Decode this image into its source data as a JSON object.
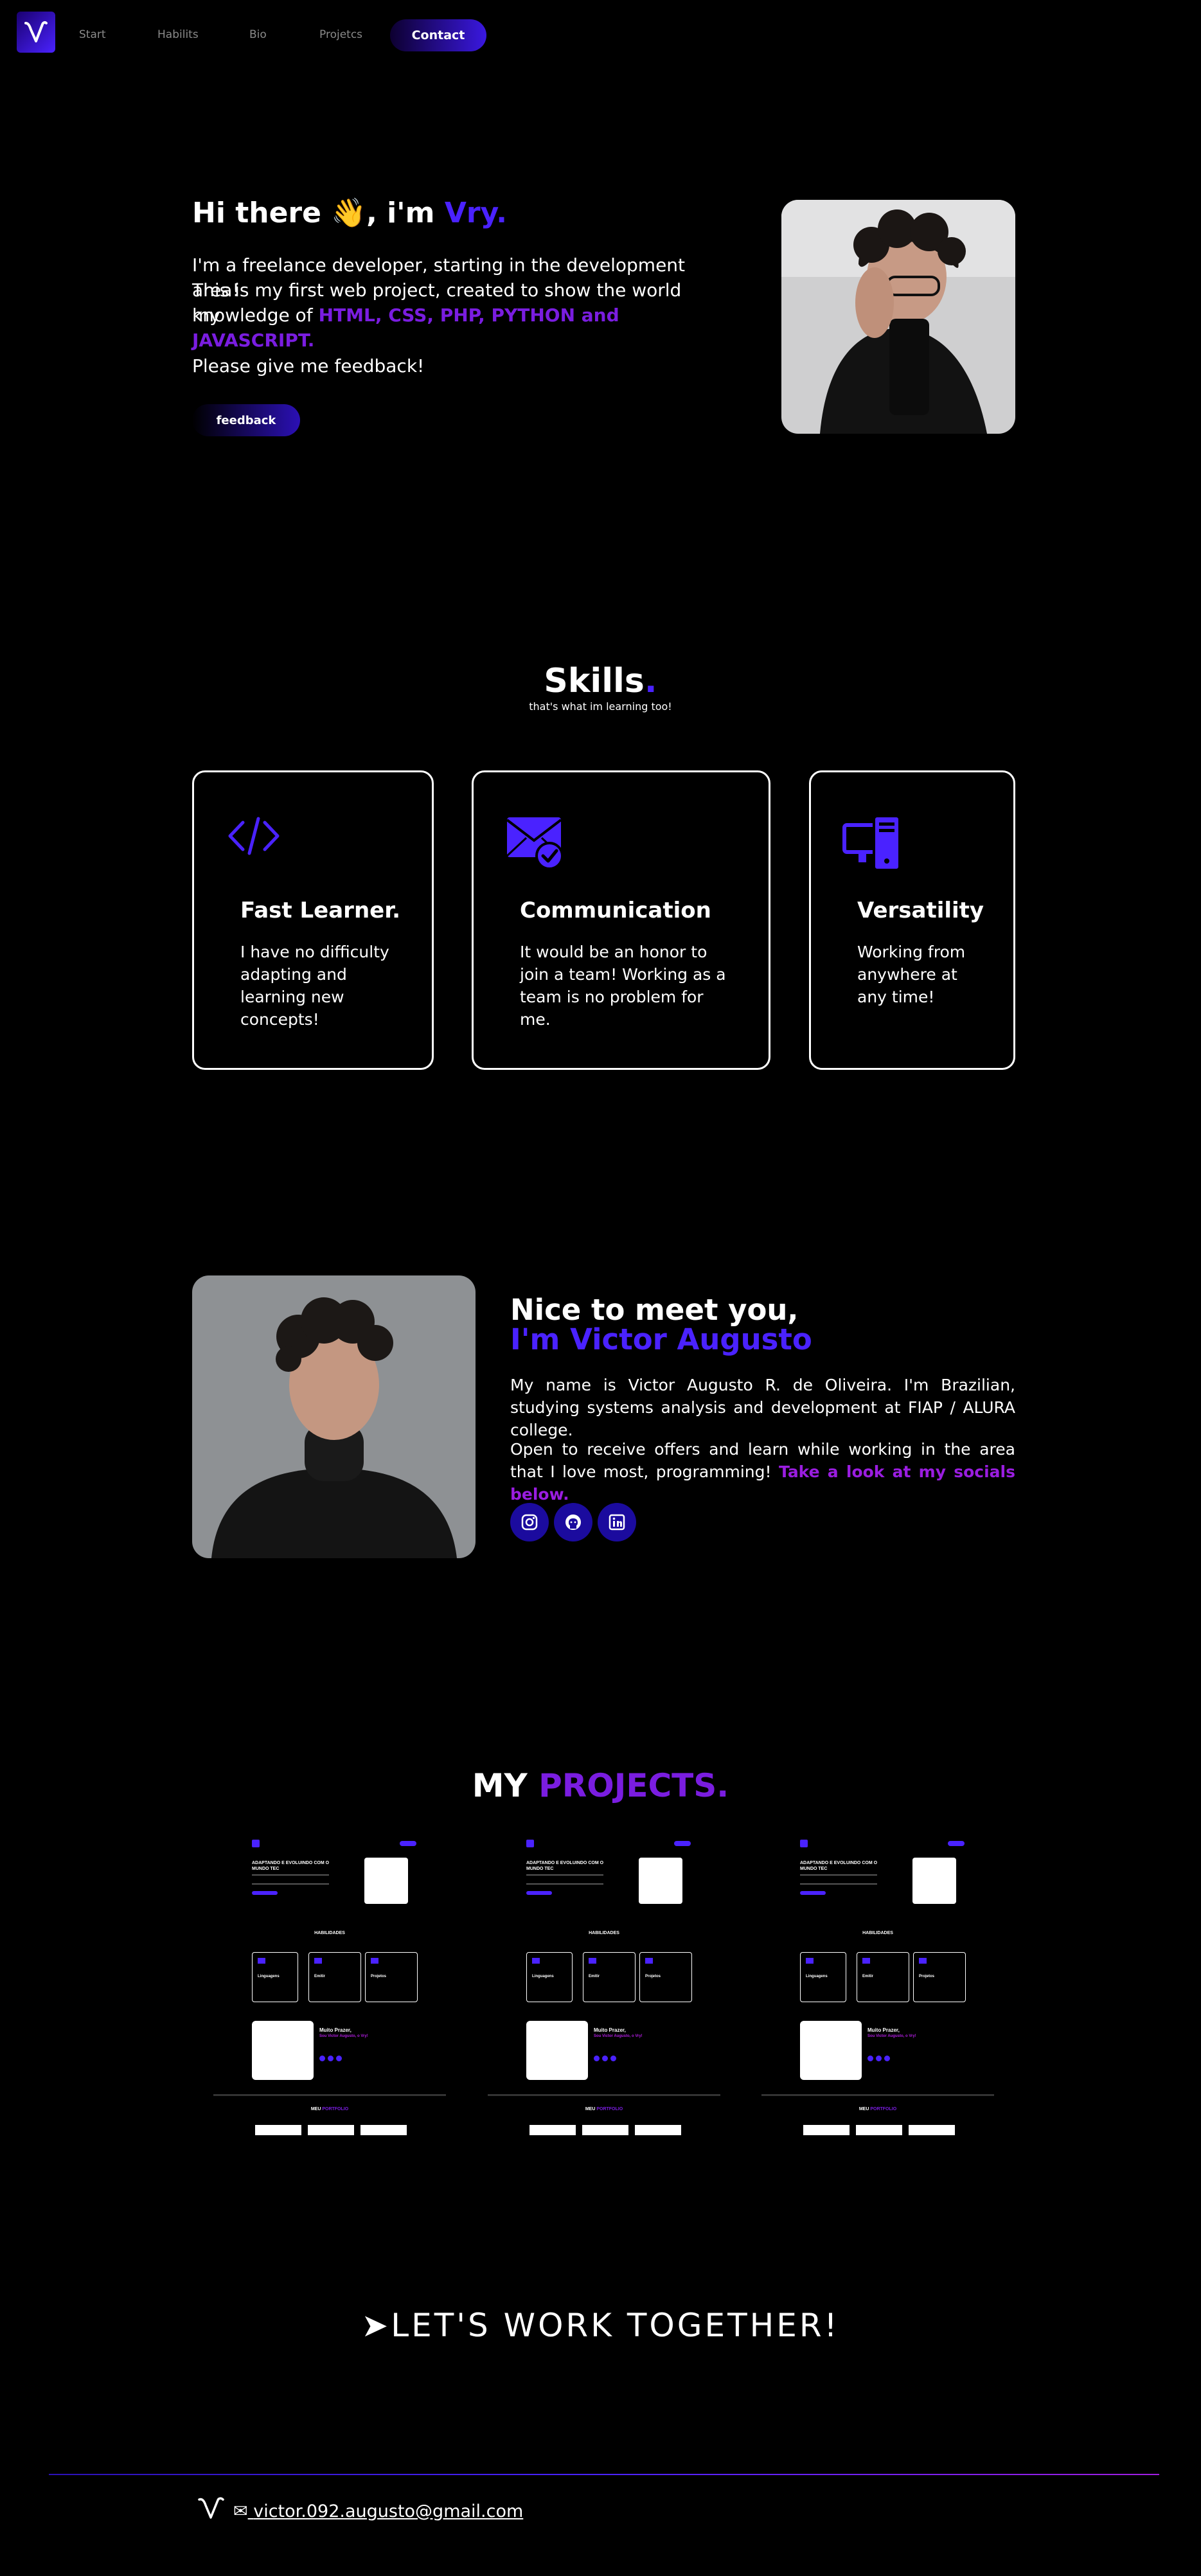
{
  "nav": {
    "logo_letter": "V",
    "links": [
      "Start",
      "Habilits",
      "Bio",
      "Projetcs"
    ],
    "contact_label": "Contact"
  },
  "hero": {
    "greeting": "Hi there 👋, i'm",
    "name": "Vry.",
    "line1": "I'm a freelance developer, starting in the development area!",
    "line2": "This is my first web project, created to show the world my",
    "line3_prefix": "knowledge of",
    "line3_skills": "HTML, CSS, PHP, PYTHON and JAVASCRIPT.",
    "feedback_text": "Please give me feedback!",
    "feedback_button": "feedback"
  },
  "skills": {
    "title": "Skills",
    "title_dot": ".",
    "subtitle": "that's what im learning too!",
    "cards": [
      {
        "icon": "code-icon",
        "title": "Fast Learner.",
        "lines": [
          "I have no difficulty",
          "adapting and",
          "learning new",
          "concepts!"
        ]
      },
      {
        "icon": "mail-check-icon",
        "title": "Communication",
        "lines": [
          "It would be an honor to",
          "join a team! Working as a",
          "team is no problem for",
          "me."
        ]
      },
      {
        "icon": "devices-icon",
        "title": "Versatility",
        "lines": [
          "Working from",
          "anywhere at",
          "any time!"
        ]
      }
    ]
  },
  "about": {
    "heading1": "Nice to meet you,",
    "heading2": "I'm Victor Augusto",
    "p1": "My name is Victor Augusto R. de Oliveira. I'm Brazilian, studying systems analysis and development at FIAP / ALURA college.",
    "p2_prefix": "Open to receive offers and learn while working in the area that I love most, programming!",
    "p2_link": "Take a look at my socials below.",
    "socials": [
      "instagram-icon",
      "github-icon",
      "linkedin-icon"
    ]
  },
  "projects": {
    "title_prefix": "MY",
    "title_accent": "PROJECTS.",
    "thumb": {
      "hero_title": "ADAPTANDO E EVOLUINDO COM O MUNDO TEC",
      "section": "HABILIDADES",
      "card_titles": [
        "Linguagens",
        "Emitir",
        "Projetos"
      ],
      "about_title": "Muito Prazer,",
      "about_name": "Sou Victor Augusto, o Vry!",
      "footer_prefix": "MEU",
      "footer_accent": "PORTFOLIO"
    }
  },
  "work_together": "➤LET'S WORK TOGETHER!",
  "footer": {
    "logo_letter": "V",
    "email": "victor.092.augusto@gmail.com"
  },
  "colors": {
    "accent": "#4a22ff",
    "accent_purple": "#7a1de0",
    "social_bg": "#1b0b9e"
  }
}
